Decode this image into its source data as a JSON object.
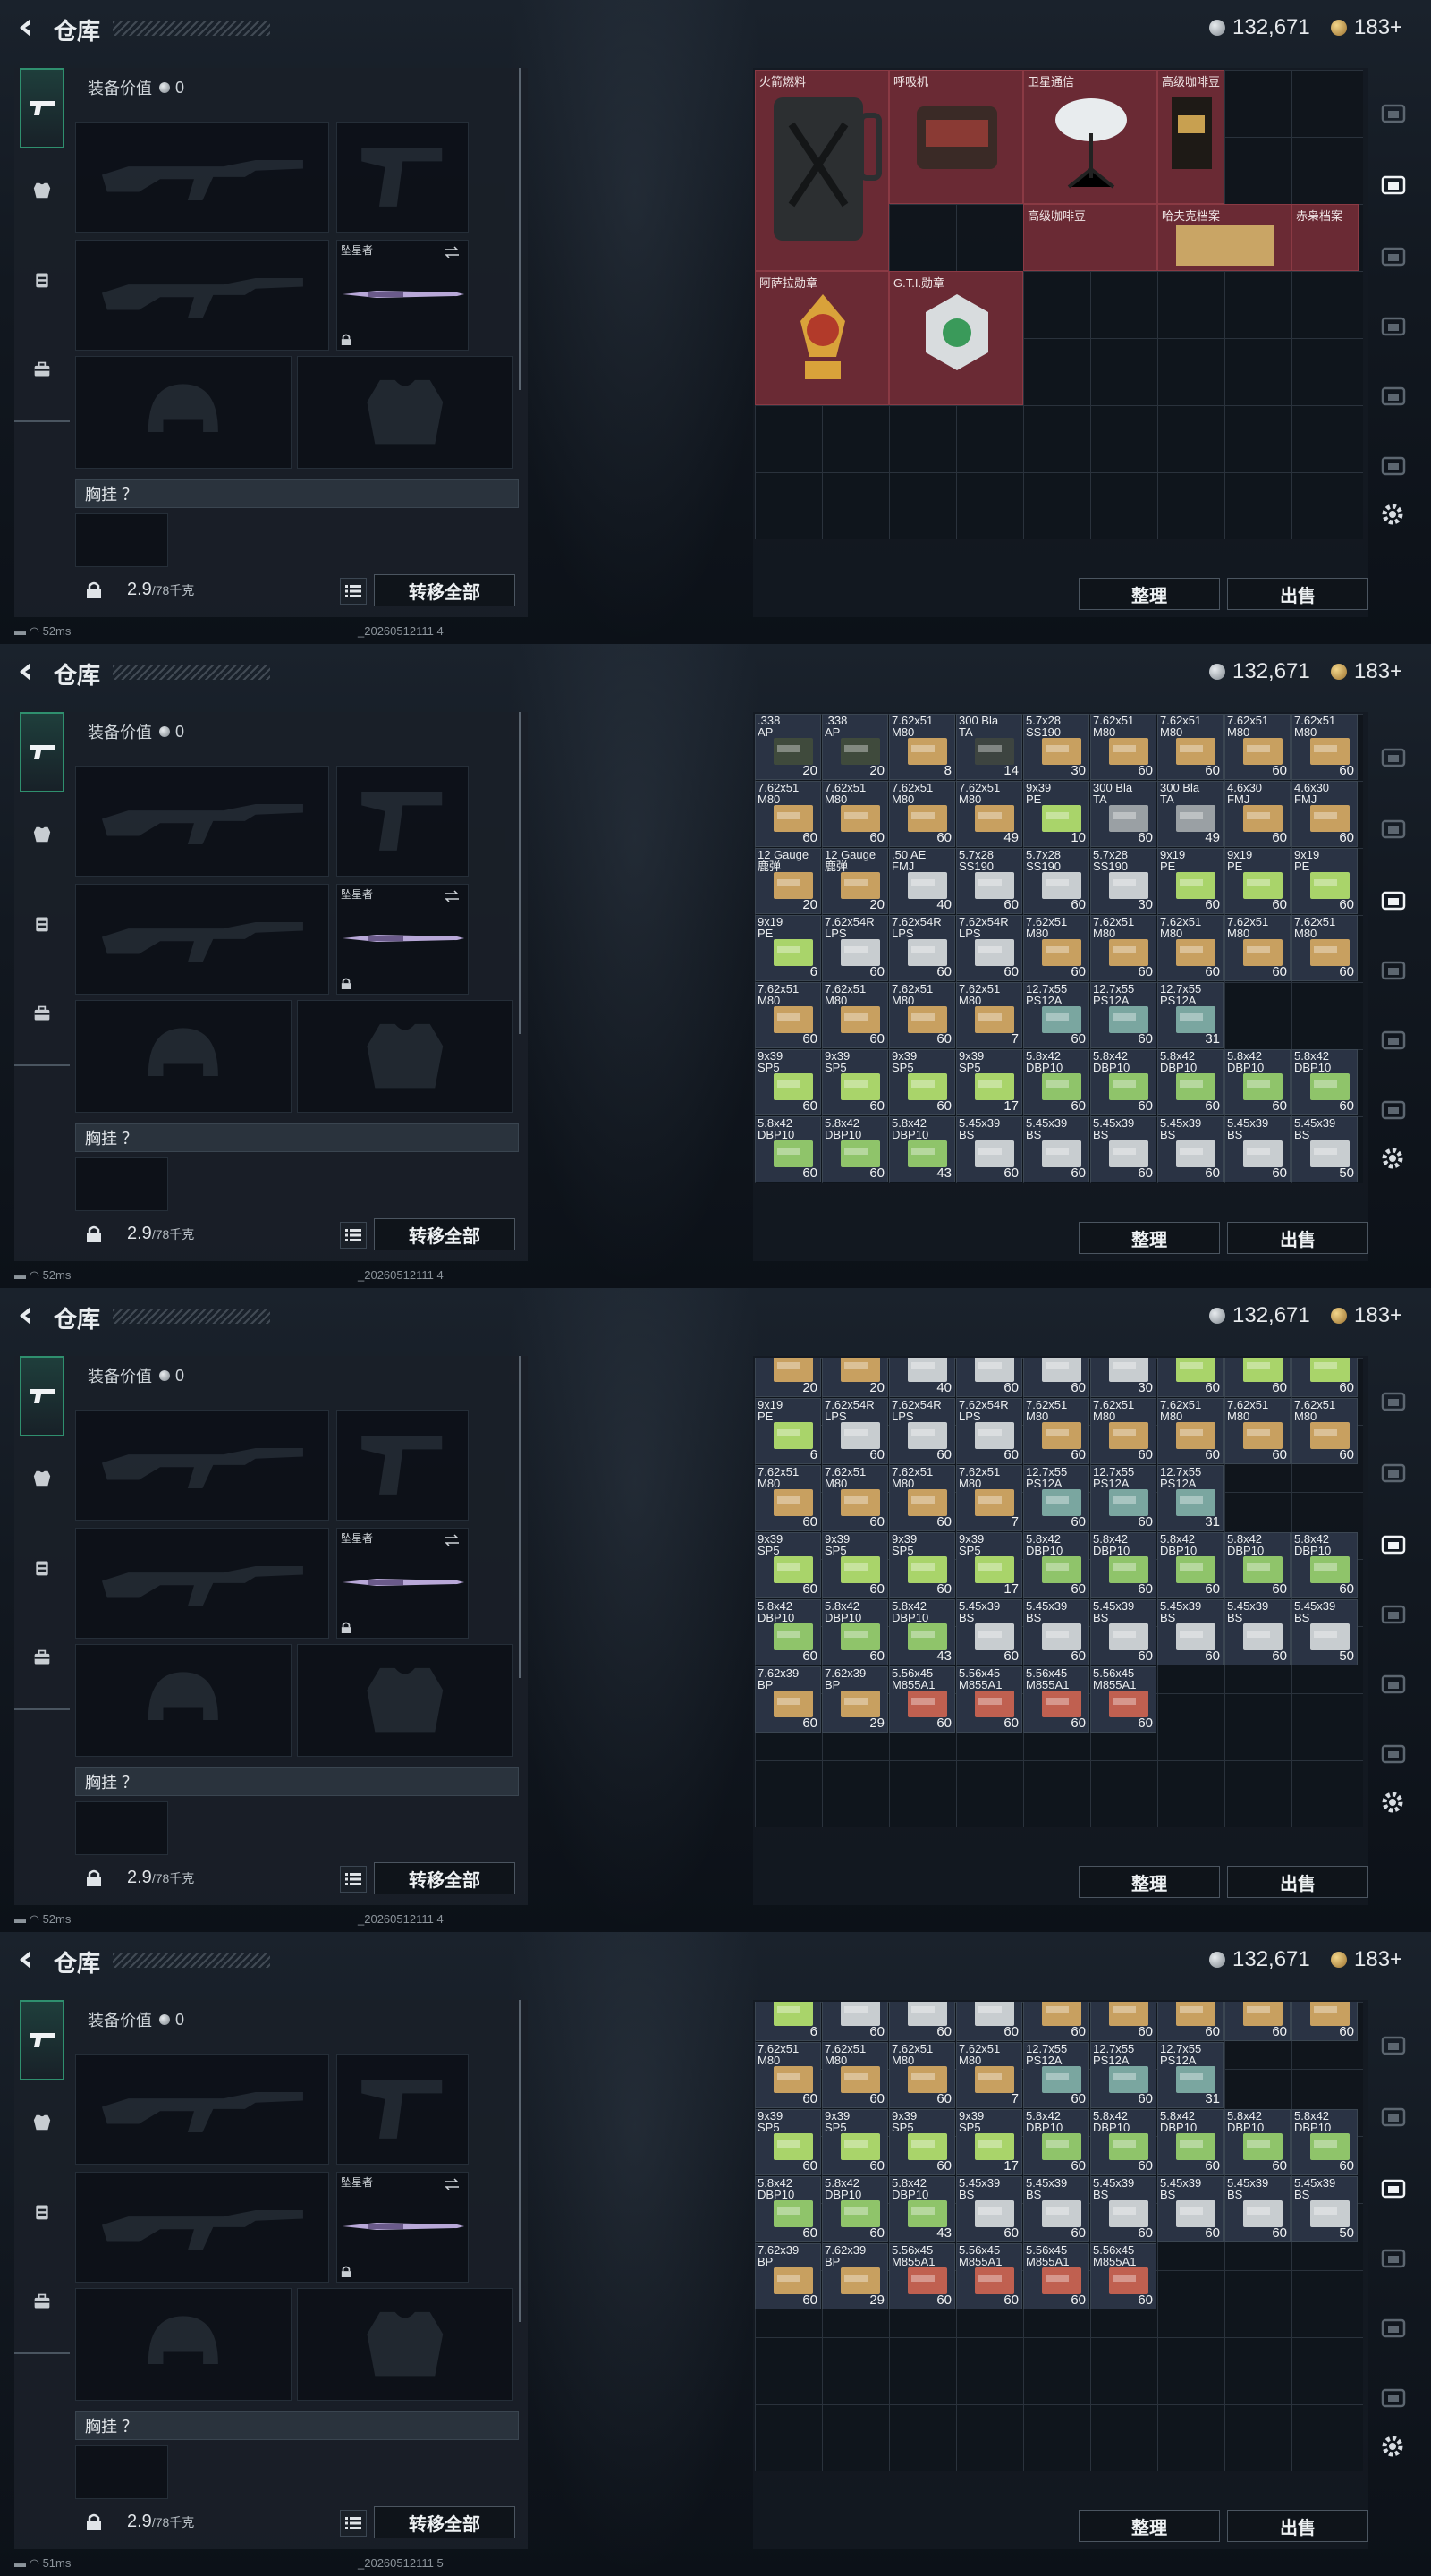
{
  "header": {
    "title": "仓库",
    "silver_amount": "132,671",
    "gold_amount": "183+"
  },
  "left": {
    "equip_value_label": "装备价值",
    "equip_value": "0",
    "melee_label": "坠星者",
    "chest_label": "胸挂 ？",
    "weight": "2.9",
    "weight_max": "/78千克",
    "transfer_all": "转移全部"
  },
  "right": {
    "sort_button": "整理",
    "sell_button": "出售"
  },
  "frames": [
    {
      "ping": "52ms",
      "build": "_20260512111 4"
    },
    {
      "ping": "52ms",
      "build": "_20260512111 4"
    },
    {
      "ping": "52ms",
      "build": "_20260512111 4"
    },
    {
      "ping": "51ms",
      "build": "_20260512111 5"
    }
  ],
  "valuables": [
    {
      "name": "火箭燃料"
    },
    {
      "name": "呼吸机"
    },
    {
      "name": "卫星通信"
    },
    {
      "name": "高级咖啡豆"
    },
    {
      "name": "高级咖啡豆"
    },
    {
      "name": "哈夫克档案"
    },
    {
      "name": "赤枭档案"
    },
    {
      "name": "阿萨拉勋章"
    },
    {
      "name": "G.T.I.勋章"
    }
  ],
  "ammo": [
    {
      "name": ".338\nAP",
      "count": "20",
      "color": "#3f4a3c"
    },
    {
      "name": ".338\nAP",
      "count": "20",
      "color": "#3f4a3c"
    },
    {
      "name": "7.62x51\nM80",
      "count": "8",
      "color": "#c8a060"
    },
    {
      "name": "300 Bla\nTA",
      "count": "14",
      "color": "#3d4440"
    },
    {
      "name": "5.7x28\nSS190",
      "count": "30",
      "color": "#c8a060"
    },
    {
      "name": "7.62x51\nM80",
      "count": "60",
      "color": "#c8a060"
    },
    {
      "name": "7.62x51\nM80",
      "count": "60",
      "color": "#c8a060"
    },
    {
      "name": "7.62x51\nM80",
      "count": "60",
      "color": "#c8a060"
    },
    {
      "name": "7.62x51\nM80",
      "count": "60",
      "color": "#c8a060"
    },
    {
      "name": "7.62x51\nM80",
      "count": "60",
      "color": "#c8a060"
    },
    {
      "name": "7.62x51\nM80",
      "count": "60",
      "color": "#c8a060"
    },
    {
      "name": "7.62x51\nM80",
      "count": "60",
      "color": "#c8a060"
    },
    {
      "name": "7.62x51\nM80",
      "count": "49",
      "color": "#c8a060"
    },
    {
      "name": "9x39\nPE",
      "count": "10",
      "color": "#a9d46a"
    },
    {
      "name": "300 Bla\nTA",
      "count": "60",
      "color": "#9aa0a4"
    },
    {
      "name": "300 Bla\nTA",
      "count": "49",
      "color": "#9aa0a4"
    },
    {
      "name": "4.6x30\nFMJ",
      "count": "60",
      "color": "#c8a060"
    },
    {
      "name": "4.6x30\nFMJ",
      "count": "60",
      "color": "#c8a060"
    },
    {
      "name": "12 Gauge\n鹿弹",
      "count": "20",
      "color": "#c8a060"
    },
    {
      "name": "12 Gauge\n鹿弹",
      "count": "20",
      "color": "#c8a060"
    },
    {
      "name": ".50 AE\nFMJ",
      "count": "40",
      "color": "#c8cdd0"
    },
    {
      "name": "5.7x28\nSS190",
      "count": "60",
      "color": "#c8cdd0"
    },
    {
      "name": "5.7x28\nSS190",
      "count": "60",
      "color": "#c8cdd0"
    },
    {
      "name": "5.7x28\nSS190",
      "count": "30",
      "color": "#c8cdd0"
    },
    {
      "name": "9x19\nPE",
      "count": "60",
      "color": "#a9d46a"
    },
    {
      "name": "9x19\nPE",
      "count": "60",
      "color": "#a9d46a"
    },
    {
      "name": "9x19\nPE",
      "count": "60",
      "color": "#a9d46a"
    },
    {
      "name": "9x19\nPE",
      "count": "6",
      "color": "#a9d46a"
    },
    {
      "name": "7.62x54R\nLPS",
      "count": "60",
      "color": "#c8cdd0"
    },
    {
      "name": "7.62x54R\nLPS",
      "count": "60",
      "color": "#c8cdd0"
    },
    {
      "name": "7.62x54R\nLPS",
      "count": "60",
      "color": "#c8cdd0"
    },
    {
      "name": "7.62x51\nM80",
      "count": "60",
      "color": "#c8a060"
    },
    {
      "name": "7.62x51\nM80",
      "count": "60",
      "color": "#c8a060"
    },
    {
      "name": "7.62x51\nM80",
      "count": "60",
      "color": "#c8a060"
    },
    {
      "name": "7.62x51\nM80",
      "count": "60",
      "color": "#c8a060"
    },
    {
      "name": "7.62x51\nM80",
      "count": "60",
      "color": "#c8a060"
    },
    {
      "name": "7.62x51\nM80",
      "count": "60",
      "color": "#c8a060"
    },
    {
      "name": "7.62x51\nM80",
      "count": "60",
      "color": "#c8a060"
    },
    {
      "name": "7.62x51\nM80",
      "count": "60",
      "color": "#c8a060"
    },
    {
      "name": "7.62x51\nM80",
      "count": "7",
      "color": "#c8a060"
    },
    {
      "name": "12.7x55\nPS12A",
      "count": "60",
      "color": "#7aa6a0"
    },
    {
      "name": "12.7x55\nPS12A",
      "count": "60",
      "color": "#7aa6a0"
    },
    {
      "name": "12.7x55\nPS12A",
      "count": "31",
      "color": "#7aa6a0"
    },
    {
      "name": "",
      "count": "",
      "color": ""
    },
    {
      "name": "",
      "count": "",
      "color": ""
    },
    {
      "name": "9x39\nSP5",
      "count": "60",
      "color": "#a9d46a"
    },
    {
      "name": "9x39\nSP5",
      "count": "60",
      "color": "#a9d46a"
    },
    {
      "name": "9x39\nSP5",
      "count": "60",
      "color": "#a9d46a"
    },
    {
      "name": "9x39\nSP5",
      "count": "17",
      "color": "#a9d46a"
    },
    {
      "name": "5.8x42\nDBP10",
      "count": "60",
      "color": "#8fc46a"
    },
    {
      "name": "5.8x42\nDBP10",
      "count": "60",
      "color": "#8fc46a"
    },
    {
      "name": "5.8x42\nDBP10",
      "count": "60",
      "color": "#8fc46a"
    },
    {
      "name": "5.8x42\nDBP10",
      "count": "60",
      "color": "#8fc46a"
    },
    {
      "name": "5.8x42\nDBP10",
      "count": "60",
      "color": "#8fc46a"
    },
    {
      "name": "5.8x42\nDBP10",
      "count": "60",
      "color": "#8fc46a"
    },
    {
      "name": "5.8x42\nDBP10",
      "count": "60",
      "color": "#8fc46a"
    },
    {
      "name": "5.8x42\nDBP10",
      "count": "43",
      "color": "#8fc46a"
    },
    {
      "name": "5.45x39\nBS",
      "count": "60",
      "color": "#c8cdd0"
    },
    {
      "name": "5.45x39\nBS",
      "count": "60",
      "color": "#c8cdd0"
    },
    {
      "name": "5.45x39\nBS",
      "count": "60",
      "color": "#c8cdd0"
    },
    {
      "name": "5.45x39\nBS",
      "count": "60",
      "color": "#c8cdd0"
    },
    {
      "name": "5.45x39\nBS",
      "count": "60",
      "color": "#c8cdd0"
    },
    {
      "name": "5.45x39\nBS",
      "count": "50",
      "color": "#c8cdd0"
    },
    {
      "name": "7.62x39\nBP",
      "count": "60",
      "color": "#c8a060"
    },
    {
      "name": "7.62x39\nBP",
      "count": "29",
      "color": "#c8a060"
    },
    {
      "name": "5.56x45\nM855A1",
      "count": "60",
      "color": "#c06050"
    },
    {
      "name": "5.56x45\nM855A1",
      "count": "60",
      "color": "#c06050"
    },
    {
      "name": "5.56x45\nM855A1",
      "count": "60",
      "color": "#c06050"
    },
    {
      "name": "5.56x45\nM855A1",
      "count": "60",
      "color": "#c06050"
    }
  ],
  "icons": {
    "back": "back-arrow-icon",
    "silver": "silver-coin-icon",
    "gold": "gold-coin-icon",
    "settings": "gear-icon"
  }
}
